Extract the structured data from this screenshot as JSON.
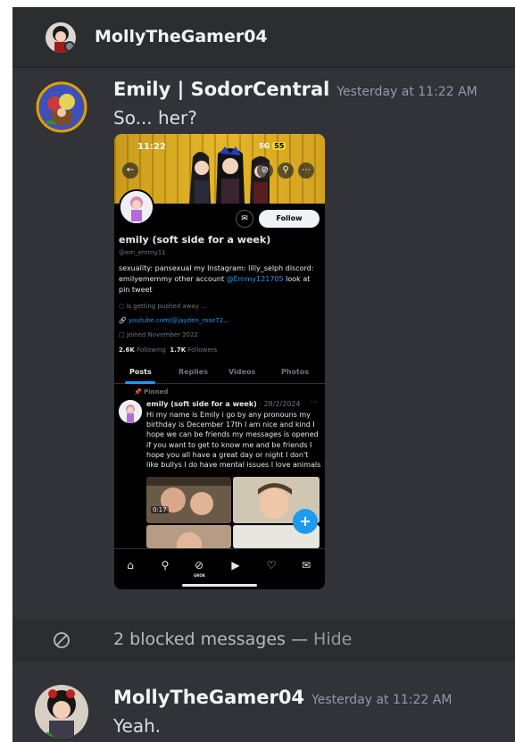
{
  "header": {
    "name": "MollyTheGamer04"
  },
  "messages": [
    {
      "author": "Emily | SodorCentral",
      "time": "Yesterday at 11:22 AM",
      "text": "So... her?"
    },
    {
      "author": "MollyTheGamer04",
      "time": "Yesterday at 11:22 AM",
      "text": "Yeah."
    }
  ],
  "attachment": {
    "status_time": "11:22",
    "status_right": "5G",
    "battery": "55",
    "follow_label": "Follow",
    "name": "emily (soft side for a week)",
    "handle": "@em_emmy11",
    "bio_part1": "sexuality: pansexual my Instagram: lilly_selph discord: emilyememmy other account ",
    "bio_link": "@Emmy121705",
    "bio_part2": " look at pin tweet",
    "location": "is getting pushed away ...",
    "website": "youtube.com/@jayden_rose72...",
    "joined": "Joined November 2022",
    "following_count": "2.6K",
    "following_label": "Following",
    "followers_count": "1.7K",
    "followers_label": "Followers",
    "tabs": [
      "Posts",
      "Replies",
      "Videos",
      "Photos"
    ],
    "pinned_label": "Pinned",
    "post_name": "emily (soft side for a week)",
    "post_date": "· 28/2/2024",
    "post_dots": "···",
    "post_text": "Hi my name is Emily i go by any pronouns my birthday is December 17th I am nice and kind I hope we can be friends my messages is opened if you want to get to know me and be friends I hope you all have a great day or night I don't like bullys I do have mental issues I love animals",
    "video_duration": "0:17",
    "grok_label": "GROK"
  },
  "blocked": {
    "text": "2 blocked messages",
    "separator": " — ",
    "hide_label": "Hide"
  },
  "colors": {
    "background": "#313338",
    "header_bg": "#2b2d31",
    "twitter_blue": "#1d9bf0"
  }
}
